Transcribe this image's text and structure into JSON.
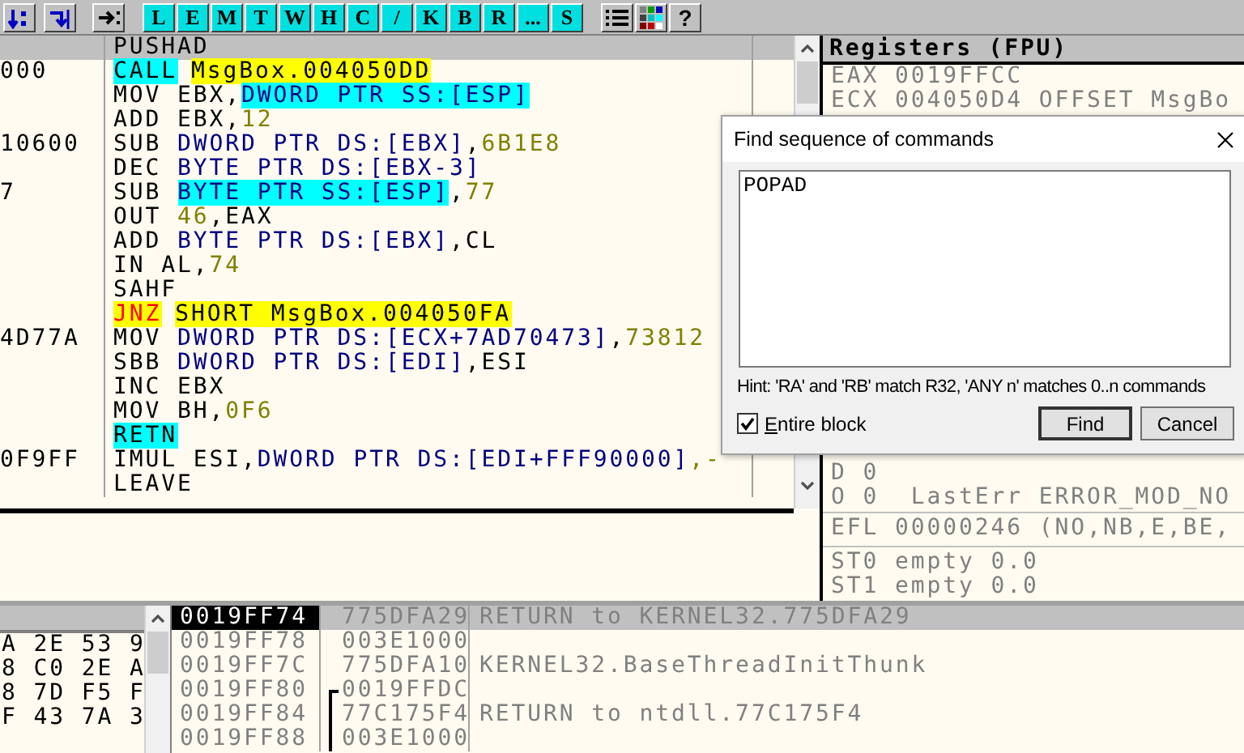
{
  "toolbar": {
    "window_buttons": [
      "L",
      "E",
      "M",
      "T",
      "W",
      "H",
      "C",
      "/",
      "K",
      "B",
      "R",
      "...",
      "S"
    ],
    "help": "?"
  },
  "disassembly": {
    "rows": [
      {
        "selected": true,
        "segments": [
          {
            "kind": "plain",
            "text": "PUSHAD"
          }
        ]
      },
      {
        "address": "000",
        "selected": false,
        "segments": [
          {
            "kind": "cyanm",
            "text": "CALL"
          },
          {
            "kind": "yellow",
            "text": "MsgBox.004050DD"
          }
        ]
      },
      {
        "selected": false,
        "segments": [
          {
            "kind": "plain",
            "text": "MOV EBX,"
          },
          {
            "kind": "cyan",
            "text": "DWORD PTR SS:[ESP]"
          }
        ]
      },
      {
        "selected": false,
        "segments": [
          {
            "kind": "plain",
            "text": "ADD EBX,"
          },
          {
            "kind": "num",
            "text": "12"
          }
        ]
      },
      {
        "address": "10600",
        "selected": false,
        "segments": [
          {
            "kind": "plain",
            "text": "SUB "
          },
          {
            "kind": "op",
            "text": "DWORD PTR DS:[EBX]"
          },
          {
            "kind": "plain",
            "text": ","
          },
          {
            "kind": "num",
            "text": "6B1E8"
          }
        ]
      },
      {
        "selected": false,
        "segments": [
          {
            "kind": "plain",
            "text": "DEC "
          },
          {
            "kind": "op",
            "text": "BYTE PTR DS:[EBX-3]"
          }
        ]
      },
      {
        "address": "7",
        "selected": false,
        "segments": [
          {
            "kind": "plain",
            "text": "SUB "
          },
          {
            "kind": "cyan",
            "text": "BYTE PTR SS:[ESP]"
          },
          {
            "kind": "plain",
            "text": ","
          },
          {
            "kind": "num",
            "text": "77"
          }
        ]
      },
      {
        "selected": false,
        "segments": [
          {
            "kind": "plain",
            "text": "OUT "
          },
          {
            "kind": "num",
            "text": "46"
          },
          {
            "kind": "plain",
            "text": ",EAX"
          }
        ]
      },
      {
        "selected": false,
        "segments": [
          {
            "kind": "plain",
            "text": "ADD "
          },
          {
            "kind": "op",
            "text": "BYTE PTR DS:[EBX]"
          },
          {
            "kind": "plain",
            "text": ",CL"
          }
        ]
      },
      {
        "selected": false,
        "segments": [
          {
            "kind": "plain",
            "text": "IN AL,"
          },
          {
            "kind": "num",
            "text": "74"
          }
        ]
      },
      {
        "selected": false,
        "segments": [
          {
            "kind": "plain",
            "text": "SAHF"
          }
        ]
      },
      {
        "selected": false,
        "segments": [
          {
            "kind": "jmp",
            "text": "JNZ"
          },
          {
            "kind": "yellow",
            "text": "SHORT MsgBox.004050FA"
          }
        ]
      },
      {
        "address": "4D77A",
        "selected": false,
        "segments": [
          {
            "kind": "plain",
            "text": "MOV "
          },
          {
            "kind": "op",
            "text": "DWORD PTR DS:[ECX+7AD70473]"
          },
          {
            "kind": "plain",
            "text": ","
          },
          {
            "kind": "num",
            "text": "73812"
          }
        ]
      },
      {
        "selected": false,
        "segments": [
          {
            "kind": "plain",
            "text": "SBB "
          },
          {
            "kind": "op",
            "text": "DWORD PTR DS:[EDI]"
          },
          {
            "kind": "plain",
            "text": ",ESI"
          }
        ]
      },
      {
        "selected": false,
        "segments": [
          {
            "kind": "plain",
            "text": "INC EBX"
          }
        ]
      },
      {
        "selected": false,
        "segments": [
          {
            "kind": "plain",
            "text": "MOV BH,"
          },
          {
            "kind": "num",
            "text": "0F6"
          }
        ]
      },
      {
        "selected": false,
        "segments": [
          {
            "kind": "cyanm",
            "text": "RETN"
          }
        ]
      },
      {
        "address": "0F9FF",
        "selected": false,
        "segments": [
          {
            "kind": "plain",
            "text": "IMUL ESI,"
          },
          {
            "kind": "op",
            "text": "DWORD PTR DS:[EDI+FFF90000]"
          },
          {
            "kind": "num",
            "text": ",-"
          }
        ]
      },
      {
        "selected": false,
        "segments": [
          {
            "kind": "plain",
            "text": "LEAVE"
          }
        ]
      }
    ]
  },
  "registers": {
    "title": "Registers (FPU)",
    "top_rows": [
      "EAX 0019FFCC",
      "ECX 004050D4 OFFSET MsgBo"
    ],
    "flag_rows": [
      "D 0",
      "O 0  LastErr ERROR_MOD_NO"
    ],
    "efl": "EFL 00000246 (NO,NB,E,BE,",
    "fpu_rows": [
      "ST0 empty 0.0",
      "ST1 empty 0.0"
    ]
  },
  "dump": {
    "rows": [
      "A 2E 53 9",
      "8 C0 2E A",
      "8 7D F5 F",
      "F 43 7A 3"
    ]
  },
  "stack": {
    "rows": [
      {
        "address": "0019FF74",
        "value": "775DFA29",
        "comment": "RETURN to KERNEL32.775DFA29",
        "selected": true,
        "kind": "plain"
      },
      {
        "address": "0019FF78",
        "value": "003E1000",
        "selected": false,
        "kind": "plain"
      },
      {
        "address": "0019FF7C",
        "value": "775DFA10",
        "comment": "KERNEL32.BaseThreadInitThunk",
        "selected": false,
        "kind": "plain"
      },
      {
        "address": "0019FF80",
        "value": "0019FFDC",
        "selected": false,
        "kind": "frame_top"
      },
      {
        "address": "0019FF84",
        "value": "77C175F4",
        "comment": "RETURN to ntdll.77C175F4",
        "selected": false,
        "kind": "frame"
      },
      {
        "address": "0019FF88",
        "value": "003E1000",
        "selected": false,
        "kind": "frame"
      }
    ]
  },
  "dialog": {
    "title": "Find sequence of commands",
    "text": "POPAD",
    "hint": "Hint: 'RA' and 'RB' match R32, 'ANY n' matches 0..n commands",
    "entire_block": {
      "label": "Entire block",
      "checked": true
    },
    "buttons": [
      {
        "label": "Find",
        "kind": "default"
      },
      {
        "label": "Cancel",
        "kind": "normal"
      }
    ]
  }
}
